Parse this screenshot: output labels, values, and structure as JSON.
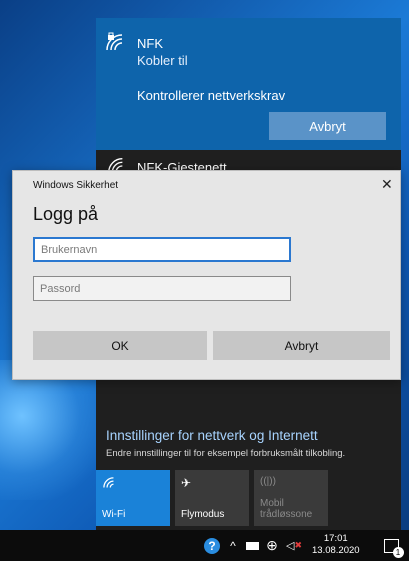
{
  "flyout": {
    "selected_network": {
      "name": "NFK",
      "status": "Kobler til",
      "check_text": "Kontrollerer nettverkskrav",
      "cancel_label": "Avbryt"
    },
    "other_network": {
      "name": "NFK-Giestenett"
    },
    "settings_link": "Innstillinger for nettverk og Internett",
    "settings_desc": "Endre innstillinger til for eksempel forbruksmålt tilkobling.",
    "tiles": [
      {
        "label": "Wi-Fi",
        "icon": "wifi-icon",
        "active": true
      },
      {
        "label": "Flymodus",
        "icon": "airplane-icon",
        "active": false
      },
      {
        "label": "Mobil\ntrådløssone",
        "icon": "hotspot-icon",
        "active": false,
        "disabled": true
      }
    ]
  },
  "dialog": {
    "window_title": "Windows Sikkerhet",
    "heading": "Logg på",
    "username_placeholder": "Brukernavn",
    "password_placeholder": "Passord",
    "ok_label": "OK",
    "cancel_label": "Avbryt"
  },
  "taskbar": {
    "time": "17:01",
    "date": "13.08.2020",
    "notification_count": "1"
  },
  "colors": {
    "accent": "#0e64ab",
    "tile_active": "#1a82d8",
    "tile_inactive": "#3a3a3a",
    "link": "#a8d4ff"
  }
}
